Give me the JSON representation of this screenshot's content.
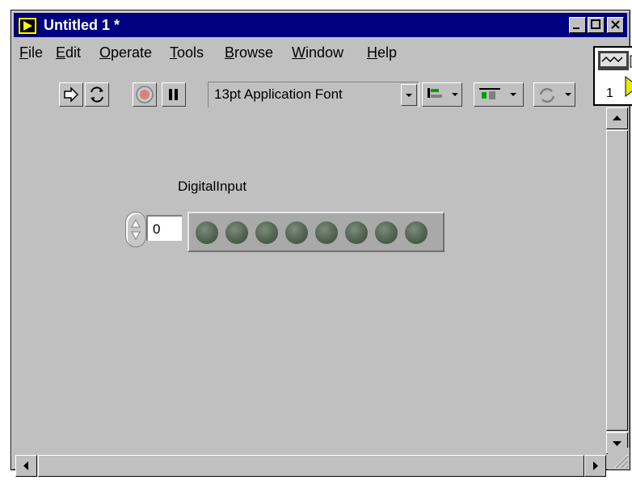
{
  "window": {
    "title": "Untitled 1 *"
  },
  "menu": [
    {
      "id": "file",
      "label": "File"
    },
    {
      "id": "edit",
      "label": "Edit"
    },
    {
      "id": "operate",
      "label": "Operate"
    },
    {
      "id": "tools",
      "label": "Tools"
    },
    {
      "id": "browse",
      "label": "Browse"
    },
    {
      "id": "window",
      "label": "Window"
    },
    {
      "id": "help",
      "label": "Help"
    }
  ],
  "toolbar": {
    "font": "13pt Application Font"
  },
  "vi_icon": {
    "number": "1"
  },
  "control": {
    "label": "DigitalInput",
    "value": "0",
    "led_count": 8
  },
  "colors": {
    "titlebar": "#000080",
    "led_off": "#4f604f"
  }
}
